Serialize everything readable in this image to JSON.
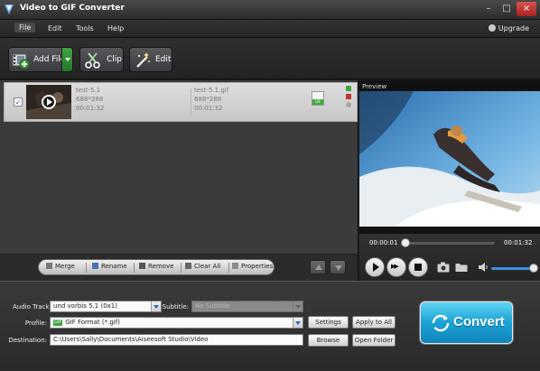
{
  "window": {
    "title": "Video to GIF Converter",
    "minimize": "–",
    "maximize": "□",
    "close": "×"
  },
  "menu": {
    "items": [
      "File",
      "Edit",
      "Tools",
      "Help"
    ],
    "upgrade": "Upgrade"
  },
  "toolbar": {
    "add_file": "Add File",
    "clip": "Clip",
    "edit": "Edit"
  },
  "file": {
    "source_name": "test-5.1",
    "source_res": "688*288",
    "source_dur": "00:01:32",
    "output_name": "test-5.1.gif",
    "output_res": "688*288",
    "output_dur": "00:01:32",
    "format_badge": "GIF",
    "checked": "✓"
  },
  "list_actions": {
    "merge": "Merge",
    "rename": "Rename",
    "remove": "Remove",
    "clear_all": "Clear All",
    "properties": "Properties"
  },
  "preview": {
    "label": "Preview",
    "current_time": "00:00:01",
    "total_time": "00:01:32",
    "progress": 0.02,
    "volume": 0.9
  },
  "settings": {
    "audio_track_label": "Audio Track:",
    "audio_track_value": "und vorbis 5.1 (0x1)",
    "subtitle_label": "Subtitle:",
    "subtitle_value": "No Subtitle",
    "profile_label": "Profile:",
    "profile_value": "GIF Format (*.gif)",
    "profile_badge": "GIF",
    "destination_label": "Destination:",
    "destination_value": "C:\\Users\\Sally\\Documents\\Aiseesoft Studio\\Video",
    "settings_button": "Settings",
    "apply_all_button": "Apply to All",
    "browse_button": "Browse",
    "open_folder_button": "Open Folder",
    "convert_button": "Convert"
  },
  "colors": {
    "accent_green": "#3fa441",
    "convert_blue": "#1aa2d6",
    "progress_blue": "#3b8ee0"
  }
}
